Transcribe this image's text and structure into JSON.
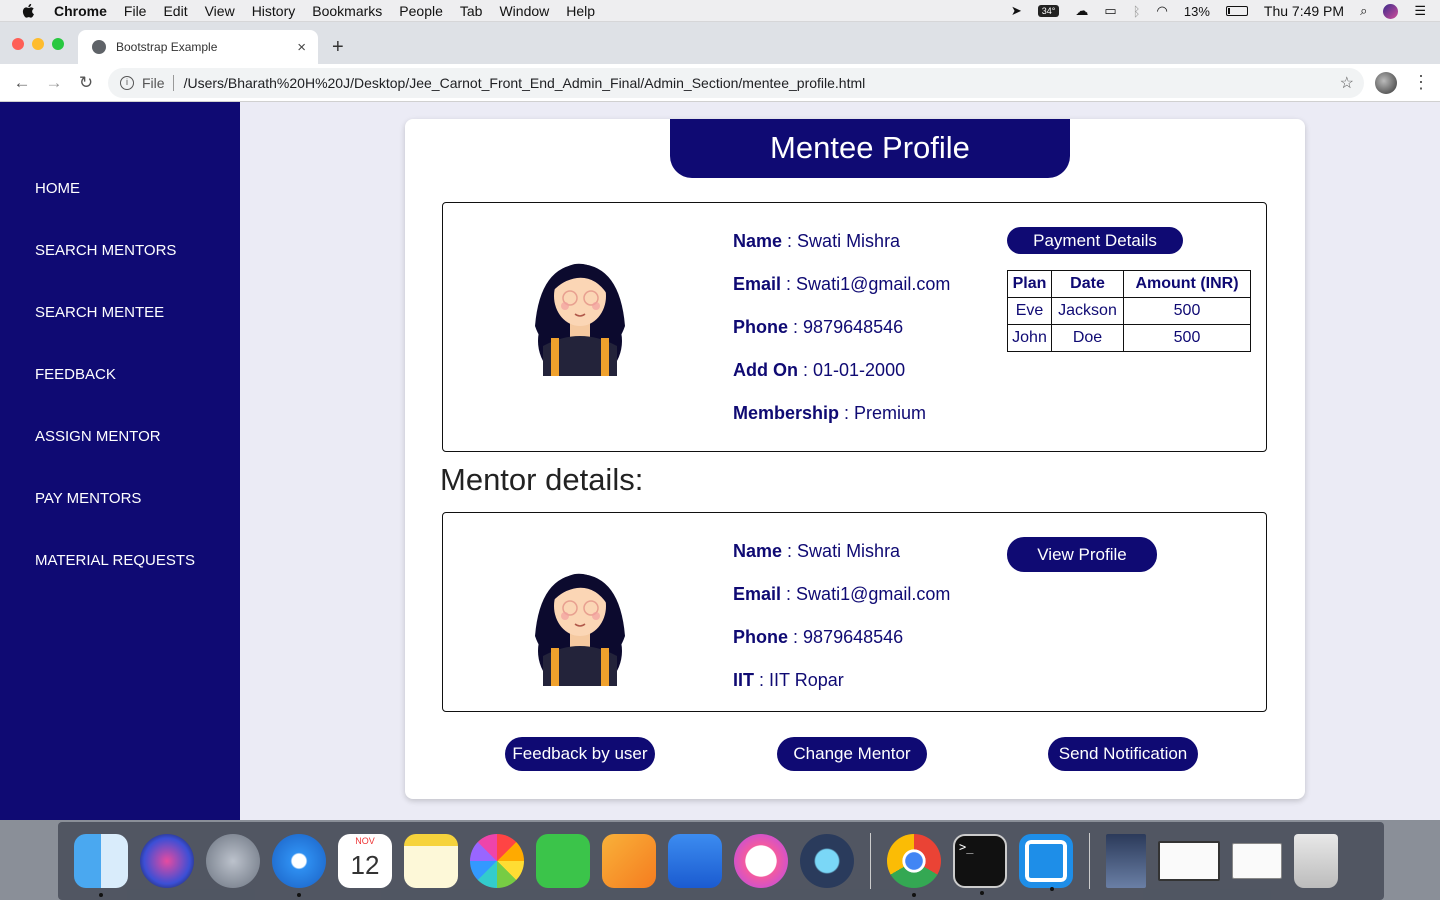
{
  "menubar": {
    "app": "Chrome",
    "items": [
      "File",
      "Edit",
      "View",
      "History",
      "Bookmarks",
      "People",
      "Tab",
      "Window",
      "Help"
    ],
    "temperature": "34°",
    "battery": "13%",
    "battery_level": 0.13,
    "clock": "Thu 7:49 PM"
  },
  "browser": {
    "tab_title": "Bootstrap Example",
    "tab_close": "×",
    "new_tab": "+",
    "scheme": "File",
    "url": "/Users/Bharath%20H%20J/Desktop/Jee_Carnot_Front_End_Admin_Final/Admin_Section/mentee_profile.html"
  },
  "sidebar": {
    "items": [
      "HOME",
      "SEARCH MENTORS",
      "SEARCH MENTEE",
      "FEEDBACK",
      "ASSIGN MENTOR",
      "PAY MENTORS",
      "MATERIAL REQUESTS"
    ]
  },
  "card": {
    "title": "Mentee Profile",
    "mentee": {
      "fields": [
        {
          "label": "Name",
          "value": "Swati Mishra"
        },
        {
          "label": "Email",
          "value": "Swati1@gmail.com"
        },
        {
          "label": "Phone",
          "value": "9879648546"
        },
        {
          "label": "Add On",
          "value": "01-01-2000"
        },
        {
          "label": "Membership",
          "value": "Premium"
        }
      ],
      "payment_button": "Payment Details",
      "payment_table": {
        "headers": [
          "Plan",
          "Date",
          "Amount (INR)"
        ],
        "rows": [
          [
            "Eve",
            "Jackson",
            "500"
          ],
          [
            "John",
            "Doe",
            "500"
          ]
        ]
      }
    },
    "mentor_section_title": "Mentor details:",
    "mentor": {
      "fields": [
        {
          "label": "Name",
          "value": "Swati Mishra"
        },
        {
          "label": "Email",
          "value": "Swati1@gmail.com"
        },
        {
          "label": "Phone",
          "value": "9879648546"
        },
        {
          "label": "IIT",
          "value": "IIT Ropar"
        }
      ],
      "view_button": "View Profile"
    },
    "actions": {
      "feedback": "Feedback by user",
      "change": "Change Mentor",
      "notify": "Send Notification"
    }
  },
  "colors": {
    "brand": "#0f0a73",
    "page_bg": "#ebebf5"
  },
  "dock": {
    "calendar_month": "NOV",
    "calendar_day": "12",
    "terminal_prompt": ">_",
    "apps": [
      "finder-icon",
      "siri-icon",
      "launchpad-icon",
      "safari-icon",
      "calendar-icon",
      "notes-icon",
      "photos-icon",
      "facetime-icon",
      "pages-icon",
      "keynote-icon",
      "itunes-icon",
      "quicktime-icon",
      "chrome-icon",
      "terminal-icon",
      "brackets-icon",
      "image-icon",
      "preview-icon",
      "preview2-icon",
      "trash-icon"
    ]
  }
}
